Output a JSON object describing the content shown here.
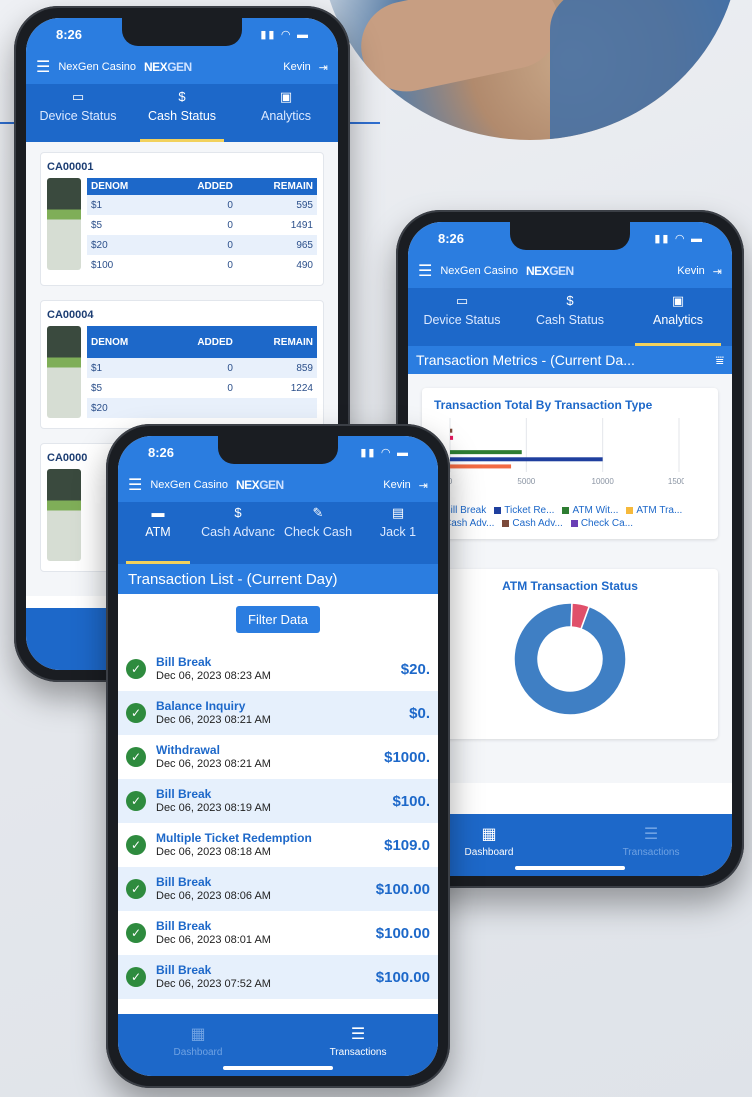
{
  "brand": {
    "app_title": "NexGen Casino",
    "logo_left": "NEX",
    "logo_right": "GEN",
    "user": "Kevin"
  },
  "status": {
    "time": "8:26"
  },
  "tabs": {
    "device": "Device Status",
    "cash": "Cash Status",
    "analytics": "Analytics"
  },
  "cassettes": [
    {
      "id": "CA00001",
      "headers": [
        "DENOM",
        "ADDED",
        "REMAIN"
      ],
      "rows": [
        [
          "$1",
          "0",
          "595"
        ],
        [
          "$5",
          "0",
          "1491"
        ],
        [
          "$20",
          "0",
          "965"
        ],
        [
          "$100",
          "0",
          "490"
        ]
      ]
    },
    {
      "id": "CA00004",
      "headers": [
        "DENOM",
        "ADDED",
        "REMAIN"
      ],
      "rows": [
        [
          "$1",
          "0",
          "859"
        ],
        [
          "$5",
          "0",
          "1224"
        ],
        [
          "$20",
          "",
          ""
        ]
      ]
    },
    {
      "id": "CA0000"
    }
  ],
  "analytics": {
    "header": "Transaction Metrics - (Current Da...",
    "chart_title": "Transaction Total By Transaction Type",
    "donut_title": "ATM Transaction Status"
  },
  "chart_data": [
    {
      "type": "bar",
      "title": "Transaction Total By Transaction Type",
      "xlim": [
        0,
        15000
      ],
      "xticks": [
        "0",
        "5000",
        "10000",
        "15000"
      ],
      "series": [
        {
          "name": "Bill Break",
          "values": [
            4000
          ],
          "color": "#f26b43"
        },
        {
          "name": "Ticket Re...",
          "values": [
            10000
          ],
          "color": "#1f3f9e"
        },
        {
          "name": "ATM Wit...",
          "values": [
            4700
          ],
          "color": "#2e7d32"
        },
        {
          "name": "ATM Tra...",
          "values": [
            0
          ],
          "color": "#f6b93b"
        },
        {
          "name": "Cash Adv...",
          "values": [
            200
          ],
          "color": "#e0185c"
        },
        {
          "name": "Cash Adv...",
          "values": [
            150
          ],
          "color": "#7b4a3a"
        },
        {
          "name": "Check Ca...",
          "values": [
            0
          ],
          "color": "#6a3fb5"
        }
      ]
    },
    {
      "type": "pie",
      "title": "ATM Transaction Status",
      "values": [
        95,
        5
      ],
      "colors": [
        "#3f7fc4",
        "#e0506a"
      ]
    }
  ],
  "atm": {
    "tabs": [
      "ATM",
      "Cash Advanc",
      "Check Cash",
      "Jack 1"
    ],
    "list_header": "Transaction List - (Current Day)",
    "filter_label": "Filter Data",
    "transactions": [
      {
        "name": "Bill Break",
        "date": "Dec 06, 2023 08:23 AM",
        "amount": "$20."
      },
      {
        "name": "Balance Inquiry",
        "date": "Dec 06, 2023 08:21 AM",
        "amount": "$0."
      },
      {
        "name": "Withdrawal",
        "date": "Dec 06, 2023 08:21 AM",
        "amount": "$1000."
      },
      {
        "name": "Bill Break",
        "date": "Dec 06, 2023 08:19 AM",
        "amount": "$100."
      },
      {
        "name": "Multiple Ticket Redemption",
        "date": "Dec 06, 2023 08:18 AM",
        "amount": "$109.0"
      },
      {
        "name": "Bill Break",
        "date": "Dec 06, 2023 08:06 AM",
        "amount": "$100.00"
      },
      {
        "name": "Bill Break",
        "date": "Dec 06, 2023 08:01 AM",
        "amount": "$100.00"
      },
      {
        "name": "Bill Break",
        "date": "Dec 06, 2023 07:52 AM",
        "amount": "$100.00"
      }
    ]
  },
  "nav": {
    "dashboard": "Dashboard",
    "transactions": "Transactions"
  }
}
